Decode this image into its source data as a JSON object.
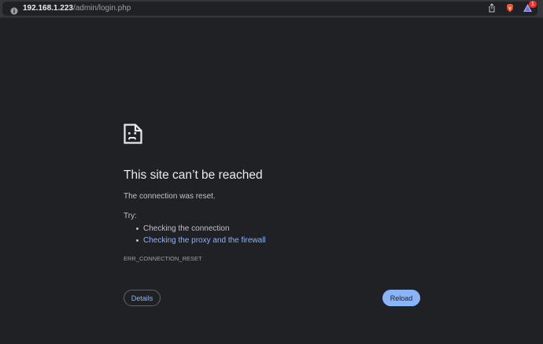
{
  "address_bar": {
    "host": "192.168.1.223",
    "path": "/admin/login.php",
    "rewards_badge_count": "1"
  },
  "icons": {
    "site_info": "info-icon",
    "share": "share-icon",
    "brave_shields": "brave-shields-icon",
    "rewards": "brave-rewards-icon",
    "error": "sad-page-icon"
  },
  "colors": {
    "background": "#202124",
    "link": "#8ab4f8",
    "badge": "#ff2a2a"
  },
  "error": {
    "title": "This site can’t be reached",
    "message": "The connection was reset.",
    "try_label": "Try:",
    "suggestions": [
      {
        "text": "Checking the connection",
        "is_link": false
      },
      {
        "text": "Checking the proxy and the firewall",
        "is_link": true
      }
    ],
    "code": "ERR_CONNECTION_RESET"
  },
  "buttons": {
    "details": "Details",
    "reload": "Reload"
  }
}
